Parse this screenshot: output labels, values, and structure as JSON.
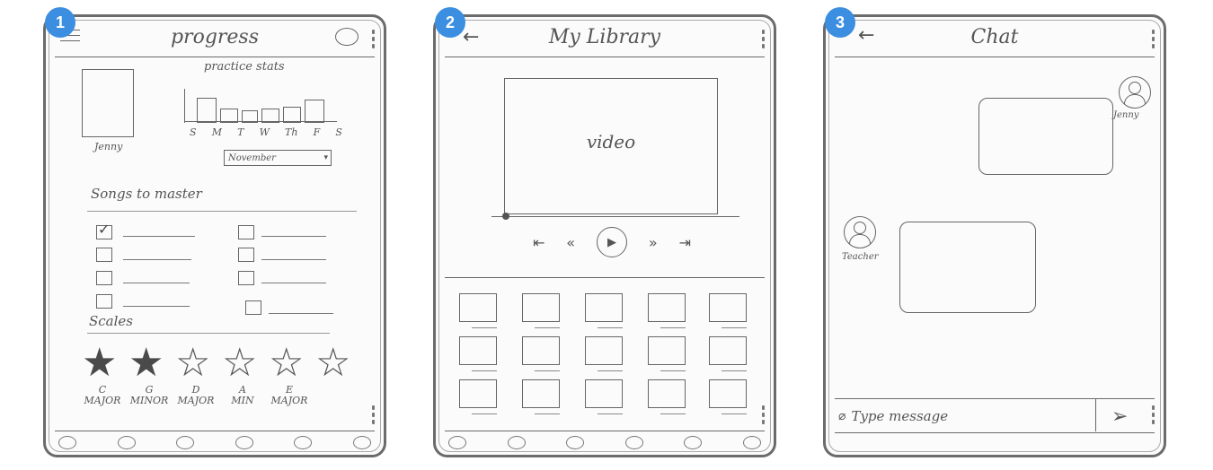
{
  "screens": [
    {
      "number": "1",
      "title": "progress",
      "subtitle": "practice stats",
      "avatar_name": "Jenny",
      "days": [
        "S",
        "M",
        "T",
        "W",
        "Th",
        "F",
        "S"
      ],
      "month_select": "November",
      "songs_heading": "Songs to master",
      "songs_checked": [
        true,
        false,
        false,
        false,
        false,
        false,
        false,
        false
      ],
      "scales_heading": "Scales",
      "scales": [
        {
          "key": "C",
          "mode": "MAJOR",
          "filled": true
        },
        {
          "key": "G",
          "mode": "MINOR",
          "filled": true
        },
        {
          "key": "D",
          "mode": "MAJOR",
          "filled": false
        },
        {
          "key": "A",
          "mode": "MIN",
          "filled": false
        },
        {
          "key": "E",
          "mode": "MAJOR",
          "filled": false
        },
        {
          "key": "",
          "mode": "",
          "filled": false
        }
      ],
      "icons": {
        "menu": "menu-icon",
        "chat": "speech-bubble-icon"
      }
    },
    {
      "number": "2",
      "title": "My Library",
      "video_label": "video",
      "controls": {
        "skip_back": "⇤",
        "rewind": "«",
        "play": "▶",
        "forward": "»",
        "skip_forward": "⇥"
      },
      "icons": {
        "back": "back-arrow-icon"
      }
    },
    {
      "number": "3",
      "title": "Chat",
      "sender_top": "Jenny",
      "sender_bottom": "Teacher",
      "input_placeholder": "Type message",
      "icons": {
        "back": "back-arrow-icon",
        "send": "send-icon",
        "attach": "attach-icon"
      }
    }
  ],
  "colors": {
    "badge": "#3b8ee0",
    "sketch": "#666666"
  }
}
